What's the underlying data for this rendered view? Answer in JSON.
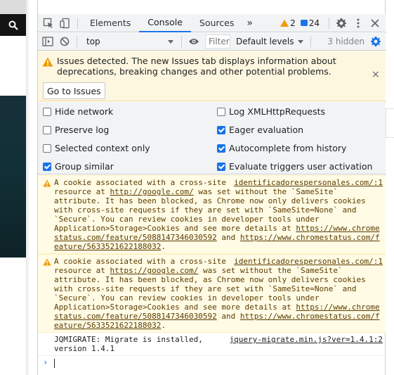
{
  "devtools": {
    "tabs": [
      "Elements",
      "Console",
      "Sources"
    ],
    "more_tabs": "»",
    "warnings_count": "2",
    "messages_count": "24"
  },
  "toolbar": {
    "context": "top",
    "filter_placeholder": "Filter",
    "levels": "Default levels",
    "hidden": "3 hidden"
  },
  "issues_banner": {
    "text": "Issues detected. The new Issues tab displays information about deprecations, breaking changes and other potential problems.",
    "button": "Go to Issues",
    "close": "×"
  },
  "settings": {
    "left": [
      {
        "label": "Hide network",
        "checked": false
      },
      {
        "label": "Preserve log",
        "checked": false
      },
      {
        "label": "Selected context only",
        "checked": false
      },
      {
        "label": "Group similar",
        "checked": true
      }
    ],
    "right": [
      {
        "label": "Log XMLHttpRequests",
        "checked": false
      },
      {
        "label": "Eager evaluation",
        "checked": true
      },
      {
        "label": "Autocomplete from history",
        "checked": true
      },
      {
        "label": "Evaluate triggers user activation",
        "checked": true
      }
    ]
  },
  "messages": [
    {
      "source": "identificadorespersonales.com/:1",
      "p1": "A cookie associated with a cross-site resource at ",
      "link": "http://google.com/",
      "p2": " was set without the `SameSite` attribute. It has been blocked, as Chrome now only delivers cookies with cross-site requests if they are set with `SameSite=None` and `Secure`. You can review cookies in developer tools under Application>Storage>Cookies and see more details at ",
      "url1": "https://www.chromestatus.com/feature/5088147346030592",
      "and": " and ",
      "url2": "https://www.chromestatus.com/feature/5633521622188032",
      "end": "."
    },
    {
      "source": "identificadorespersonales.com/:1",
      "p1": "A cookie associated with a cross-site resource at ",
      "link": "https://google.com/",
      "p2": " was set without the `SameSite` attribute. It has been blocked, as Chrome now only delivers cookies with cross-site requests if they are set with `SameSite=None` and `Secure`. You can review cookies in developer tools under Application>Storage>Cookies and see more details at ",
      "url1": "https://www.chromestatus.com/feature/5088147346030592",
      "and": " and ",
      "url2": "https://www.chromestatus.com/feature/5633521622188032",
      "end": "."
    }
  ],
  "info": {
    "text": "JQMIGRATE: Migrate is installed, version 1.4.1",
    "source": "jquery-migrate.min.js?ver=1.4.1:2"
  },
  "prompt": {
    "chevron": "›"
  },
  "colors": {
    "accent": "#1a73e8",
    "warning": "#f29900",
    "warning_bg": "#fffbe5",
    "banner_bg": "#fef7e0"
  },
  "icons": [
    "search-icon",
    "inspect-icon",
    "device-icon",
    "gear-icon",
    "kebab-icon",
    "close-icon",
    "sidebar-icon",
    "clear-icon",
    "eye-icon",
    "warning-icon",
    "settings-gear-icon",
    "star-icon"
  ]
}
